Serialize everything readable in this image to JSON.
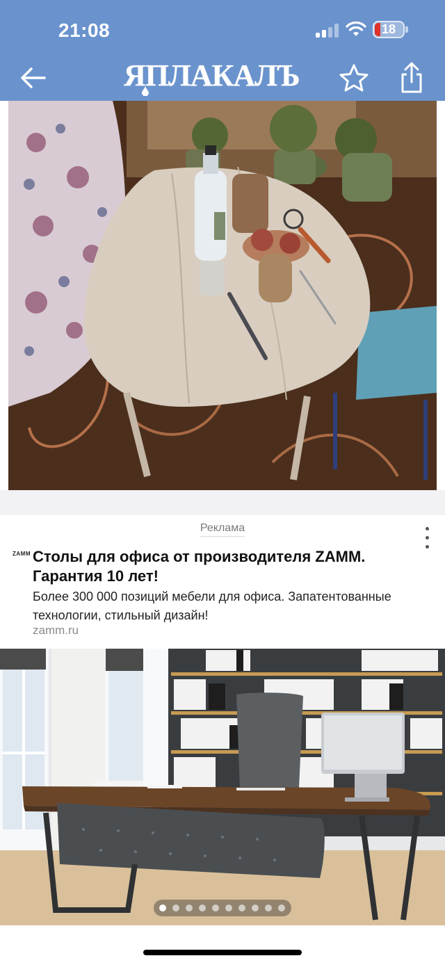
{
  "status_bar": {
    "time": "21:08",
    "battery_level": "18",
    "icons": [
      "signal-icon",
      "wifi-icon",
      "battery-icon"
    ],
    "battery_color": "#e0322b"
  },
  "header": {
    "logo_text": "ЯПЛАКАЛЪ",
    "back_icon": "back-arrow-icon",
    "favorite_icon": "star-icon",
    "share_icon": "share-icon",
    "background_color": "#6a93cd"
  },
  "ad": {
    "label": "Реклама",
    "advertiser_logo": "ZAMM",
    "title": "Столы для офиса от производителя ZAMM. Гарантия 10 лет!",
    "description": "Более 300 000 позиций мебели для офиса. Запатентованные технологии, стильный дизайн!",
    "domain": "zamm.ru",
    "menu_icon": "more-vertical-icon",
    "carousel": {
      "total": 10,
      "active_index": 0
    }
  }
}
